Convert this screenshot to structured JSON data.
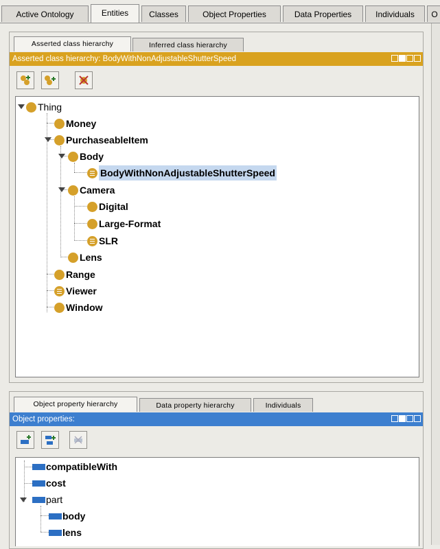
{
  "top_tabs": [
    {
      "label": "Active Ontology"
    },
    {
      "label": "Entities"
    },
    {
      "label": "Classes"
    },
    {
      "label": "Object Properties"
    },
    {
      "label": "Data Properties"
    },
    {
      "label": "Individuals"
    },
    {
      "label": "O"
    }
  ],
  "class_panel": {
    "tabs": [
      {
        "label": "Asserted class hierarchy"
      },
      {
        "label": "Inferred class hierarchy"
      }
    ],
    "title": "Asserted class hierarchy: BodyWithNonAdjustableShutterSpeed",
    "tree": [
      {
        "label": "Thing"
      },
      {
        "label": "Money"
      },
      {
        "label": "PurchaseableItem"
      },
      {
        "label": "Body"
      },
      {
        "label": "BodyWithNonAdjustableShutterSpeed"
      },
      {
        "label": "Camera"
      },
      {
        "label": "Digital"
      },
      {
        "label": "Large-Format"
      },
      {
        "label": "SLR"
      },
      {
        "label": "Lens"
      },
      {
        "label": "Range"
      },
      {
        "label": "Viewer"
      },
      {
        "label": "Window"
      }
    ]
  },
  "property_panel": {
    "tabs": [
      {
        "label": "Object property hierarchy"
      },
      {
        "label": "Data property hierarchy"
      },
      {
        "label": "Individuals"
      }
    ],
    "title": "Object properties:",
    "tree": [
      {
        "label": "compatibleWith"
      },
      {
        "label": "cost"
      },
      {
        "label": "part"
      },
      {
        "label": "body"
      },
      {
        "label": "lens"
      }
    ]
  },
  "colors": {
    "title_bar_class": "#d9a21f",
    "title_bar_property": "#3d7fcf",
    "class_dot": "#d5a02a",
    "property_bar": "#2c6fc3",
    "selection": "#c5d8ef"
  },
  "icons": [
    "add-subclass-icon",
    "add-sibling-class-icon",
    "delete-class-icon",
    "add-subproperty-icon",
    "add-sibling-property-icon",
    "delete-property-icon",
    "expand-triangle-icon",
    "equivalent-class-icon"
  ]
}
